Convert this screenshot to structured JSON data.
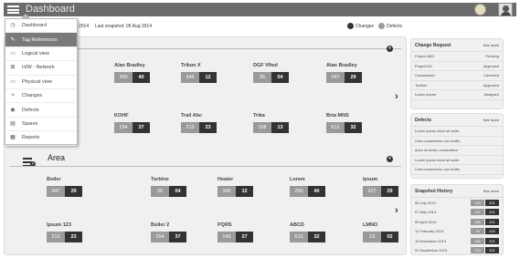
{
  "topbar": {
    "title": "Dashboard"
  },
  "subheader": {
    "year_fragment": "2014",
    "snapshot": "Last snapshot: 05 Aug 2014"
  },
  "legend": {
    "changes": {
      "label": "Changes",
      "color": "#333333"
    },
    "defects": {
      "label": "Defects",
      "color": "#9a9a9a"
    }
  },
  "menu": [
    {
      "label": "Dashboard",
      "icon": "dashboard-icon",
      "glyph": "◷",
      "active": false
    },
    {
      "label": "Tag References",
      "icon": "tag-icon",
      "glyph": "✎",
      "active": true
    },
    {
      "label": "Logical view",
      "icon": "logical-view-icon",
      "glyph": "▭",
      "active": false
    },
    {
      "label": "H/W - Network",
      "icon": "network-icon",
      "glyph": "⊞",
      "active": false
    },
    {
      "label": "Physical view",
      "icon": "physical-view-icon",
      "glyph": "▭",
      "active": false
    },
    {
      "label": "Changes",
      "icon": "wrench-icon",
      "glyph": "✧",
      "active": false
    },
    {
      "label": "Defects",
      "icon": "defect-icon",
      "glyph": "◉",
      "active": false
    },
    {
      "label": "Spares",
      "icon": "spares-icon",
      "glyph": "▤",
      "active": false
    },
    {
      "label": "Reports",
      "icon": "report-icon",
      "glyph": "▦",
      "active": false
    }
  ],
  "top_section": {
    "row1": [
      {
        "name": "",
        "v1": "",
        "v2": ""
      },
      {
        "name": "Alan Bradley",
        "v1": "260",
        "v2": "40"
      },
      {
        "name": "Trikon X",
        "v1": "346",
        "v2": "12"
      },
      {
        "name": "DGF Vfted",
        "v1": "26",
        "v2": "04"
      },
      {
        "name": "Alan Bradley",
        "v1": "347",
        "v2": "29"
      }
    ],
    "row2": [
      {
        "name": "",
        "v1": "",
        "v2": ""
      },
      {
        "name": "KOHF",
        "v1": "154",
        "v2": "37"
      },
      {
        "name": "Trail Abc",
        "v1": "213",
        "v2": "23"
      },
      {
        "name": "Trika",
        "v1": "158",
        "v2": "13"
      },
      {
        "name": "Brta MNS",
        "v1": "612",
        "v2": "32"
      }
    ]
  },
  "area_section": {
    "title": "Area",
    "row1": [
      {
        "name": "Boiler",
        "v1": "347",
        "v2": "29"
      },
      {
        "name": "Turbine",
        "v1": "26",
        "v2": "04"
      },
      {
        "name": "Heater",
        "v1": "346",
        "v2": "12"
      },
      {
        "name": "Lorem",
        "v1": "260",
        "v2": "40"
      },
      {
        "name": "Ipsum",
        "v1": "227",
        "v2": "29"
      }
    ],
    "row2": [
      {
        "name": "Ipsum 123",
        "v1": "213",
        "v2": "23"
      },
      {
        "name": "Boiler 2",
        "v1": "154",
        "v2": "37"
      },
      {
        "name": "PQRS",
        "v1": "143",
        "v2": "27"
      },
      {
        "name": "ABCD",
        "v1": "612",
        "v2": "32"
      },
      {
        "name": "LMNO",
        "v1": "13",
        "v2": "02"
      }
    ]
  },
  "change_request": {
    "title": "Change Request",
    "see_more": "See more",
    "rows": [
      {
        "name": "Project ABC",
        "status": "Pending"
      },
      {
        "name": "Project DC",
        "status": "Approved"
      },
      {
        "name": "Compressor",
        "status": "Canceled"
      },
      {
        "name": "Turbine",
        "status": "Approved"
      },
      {
        "name": "Lorem ipsum",
        "status": "Assigned"
      }
    ]
  },
  "defects": {
    "title": "Defects",
    "see_more": "See more",
    "rows": [
      "Lorem ipsum dolor sit amet",
      "Cras consectetur orci mollis",
      "dolor sit amet, consectetur",
      "Lorem ipsum dolor sit amet",
      "Cras consectetur orci mollis"
    ]
  },
  "snapshot_history": {
    "title": "Snapshot History",
    "see_more": "See more",
    "rows": [
      {
        "date": "05 July 2014",
        "v1": "125",
        "v2": "321"
      },
      {
        "date": "07 May 2014",
        "v1": "231",
        "v2": "321"
      },
      {
        "date": "05 April 2014",
        "v1": "156",
        "v2": "321"
      },
      {
        "date": "11 February 2014",
        "v1": "76",
        "v2": "432"
      },
      {
        "date": "10 November 2013",
        "v1": "156",
        "v2": "321"
      },
      {
        "date": "03 September 2013",
        "v1": "123",
        "v2": "321"
      }
    ]
  }
}
